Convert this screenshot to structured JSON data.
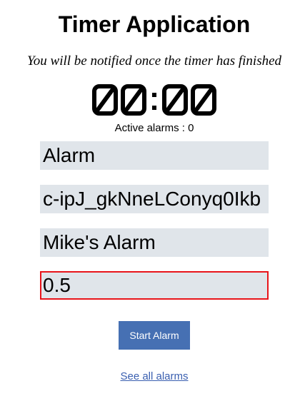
{
  "header": {
    "title": "Timer Application",
    "subtitle": "You will be notified once the timer has finished"
  },
  "timer": {
    "display": "00:00"
  },
  "status": {
    "active_alarms": "Active alarms : 0"
  },
  "form": {
    "field_1_value": "Alarm",
    "field_2_value": "c-ipJ_gkNneLConyq0Ikb",
    "field_3_value": "Mike's Alarm",
    "field_4_value": "0.5"
  },
  "actions": {
    "start_label": "Start Alarm",
    "see_all_label": "See all alarms"
  },
  "colors": {
    "button": "#4670b3",
    "field_background": "#e0e5ea",
    "invalid_border": "#e8141a",
    "link": "#3a5fb0"
  }
}
